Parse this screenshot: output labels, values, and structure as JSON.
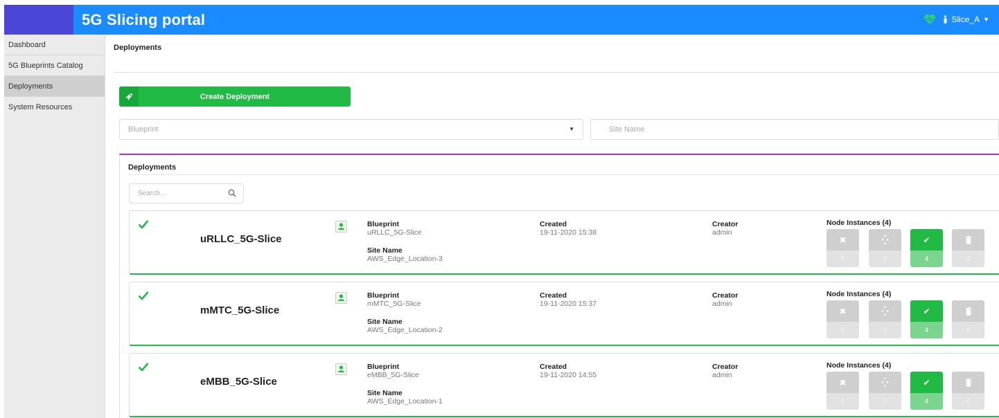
{
  "header": {
    "title": "5G Slicing portal",
    "user": "Slice_A"
  },
  "sidebar": {
    "items": [
      {
        "label": "Dashboard"
      },
      {
        "label": "5G Blueprints Catalog"
      },
      {
        "label": "Deployments"
      },
      {
        "label": "System Resources"
      }
    ],
    "active": "Deployments"
  },
  "page": {
    "title": "Deployments"
  },
  "create_button": {
    "label": "Create Deployment"
  },
  "filters": {
    "blueprint_placeholder": "Blueprint",
    "site_placeholder": "Site Name"
  },
  "panel": {
    "title": "Deployments",
    "search_placeholder": "Search..."
  },
  "deployments": [
    {
      "name": "uRLLC_5G-Slice",
      "blueprint_label": "Blueprint",
      "blueprint": "uRLLC_5G-Slice",
      "site_label": "Site Name",
      "site": "AWS_Edge_Location-3",
      "created_label": "Created",
      "created": "19-11-2020 15:38",
      "creator_label": "Creator",
      "creator": "admin",
      "nodes_label": "Node Instances (4)",
      "counts": {
        "failed": "0",
        "in_progress": "0",
        "started": "4",
        "deleted": "0"
      }
    },
    {
      "name": "mMTC_5G-Slice",
      "blueprint_label": "Blueprint",
      "blueprint": "mMTC_5G-Slice",
      "site_label": "Site Name",
      "site": "AWS_Edge_Location-2",
      "created_label": "Created",
      "created": "19-11-2020 15:37",
      "creator_label": "Creator",
      "creator": "admin",
      "nodes_label": "Node Instances (4)",
      "counts": {
        "failed": "0",
        "in_progress": "0",
        "started": "4",
        "deleted": "0"
      }
    },
    {
      "name": "eMBB_5G-Slice",
      "blueprint_label": "Blueprint",
      "blueprint": "eMBB_5G-Slice",
      "site_label": "Site Name",
      "site": "AWS_Edge_Location-1",
      "created_label": "Created",
      "created": "19-11-2020 14:55",
      "creator_label": "Creator",
      "creator": "admin",
      "nodes_label": "Node Instances (4)",
      "counts": {
        "failed": "0",
        "in_progress": "0",
        "started": "4",
        "deleted": "0"
      }
    }
  ],
  "colors": {
    "header": "#1a8cff",
    "accent": "#21ba45",
    "panel_border": "#a333c8"
  },
  "icons": [
    "heart-icon",
    "user-icon",
    "rocket-icon",
    "search-icon",
    "check-icon",
    "x-icon",
    "spinner-icon",
    "trash-icon"
  ]
}
